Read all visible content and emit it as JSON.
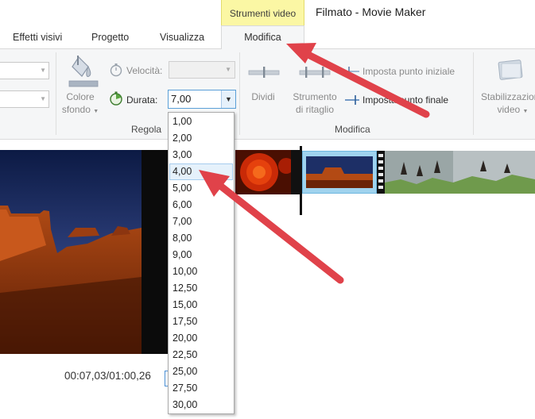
{
  "header": {
    "context_tab": "Strumenti video",
    "window_title": "Filmato - Movie Maker"
  },
  "tabs": [
    {
      "label": "Effetti visivi"
    },
    {
      "label": "Progetto"
    },
    {
      "label": "Visualizza"
    },
    {
      "label": "Modifica",
      "active": true
    }
  ],
  "ribbon": {
    "colore_sfondo": {
      "line1": "Colore",
      "line2": "sfondo"
    },
    "velocita_label": "Velocità:",
    "durata_label": "Durata:",
    "durata_value": "7,00",
    "regola_group": "Regola",
    "dividi": "Dividi",
    "strumento_ritaglio": {
      "line1": "Strumento",
      "line2": "di ritaglio"
    },
    "imposta_iniziale": "Imposta punto iniziale",
    "imposta_finale": "Imposta punto finale",
    "modifica_group": "Modifica",
    "stabilizzazione": {
      "line1": "Stabilizzazione",
      "line2": "video"
    }
  },
  "dropdown": {
    "options": [
      "1,00",
      "2,00",
      "3,00",
      "4,00",
      "5,00",
      "6,00",
      "7,00",
      "8,00",
      "9,00",
      "10,00",
      "12,50",
      "15,00",
      "17,50",
      "20,00",
      "22,50",
      "25,00",
      "27,50",
      "30,00"
    ],
    "highlighted": "4,00"
  },
  "preview": {
    "time": "00:07,03/01:00,26"
  },
  "colors": {
    "context_tab": "#fbf7a4",
    "annotation_arrow": "#e0424a",
    "selection": "#9fd3ee"
  }
}
